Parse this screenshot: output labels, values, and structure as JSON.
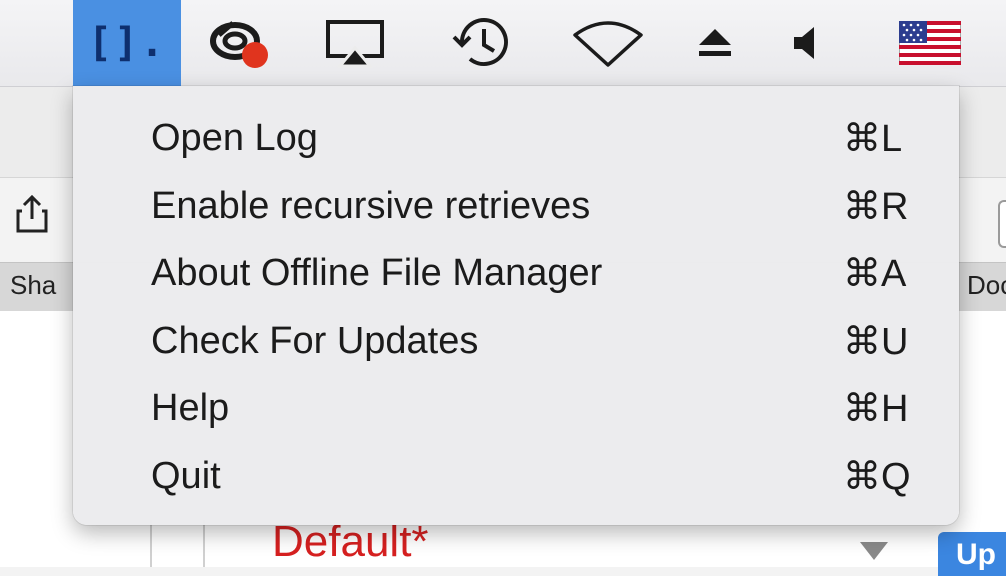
{
  "menubar": {
    "items": [
      {
        "icon": "offline-file-manager-icon",
        "label": "[].",
        "active": true
      },
      {
        "icon": "sync-status-icon"
      },
      {
        "icon": "airplay-icon"
      },
      {
        "icon": "time-machine-icon"
      },
      {
        "icon": "wifi-icon"
      },
      {
        "icon": "eject-icon"
      },
      {
        "icon": "volume-icon"
      },
      {
        "icon": "us-flag-input-icon"
      }
    ],
    "colors": {
      "highlight": "#4a90e2",
      "badge": "#e0341e"
    }
  },
  "menu": {
    "items": [
      {
        "label": "Open Log",
        "shortcut": "⌘L"
      },
      {
        "label": "Enable recursive retrieves",
        "shortcut": "⌘R"
      },
      {
        "label": "About Offline File Manager",
        "shortcut": "⌘A"
      },
      {
        "label": "Check For Updates",
        "shortcut": "⌘U"
      },
      {
        "label": "Help",
        "shortcut": "⌘H"
      },
      {
        "label": "Quit",
        "shortcut": "⌘Q"
      }
    ]
  },
  "background": {
    "share_label": "Sha",
    "right_label": "Doc",
    "default_label": "Default*",
    "up_button": "Up",
    "accent": "#d62020"
  }
}
